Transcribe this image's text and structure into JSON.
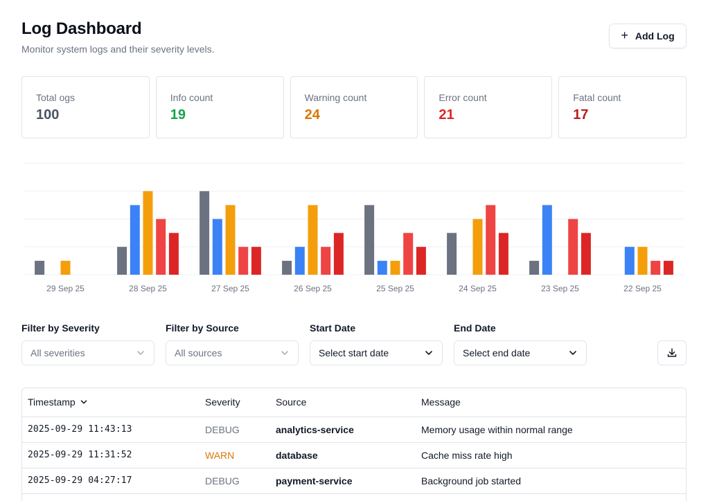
{
  "header": {
    "title": "Log Dashboard",
    "subtitle": "Monitor system logs and their severity levels."
  },
  "add_button": {
    "label": "Add Log"
  },
  "stats": [
    {
      "label": "Total ogs",
      "value": "100",
      "color": "#4b5563"
    },
    {
      "label": "Info count",
      "value": "19",
      "color": "#16a34a"
    },
    {
      "label": "Warning count",
      "value": "24",
      "color": "#d97706"
    },
    {
      "label": "Error count",
      "value": "21",
      "color": "#dc2626"
    },
    {
      "label": "Fatal count",
      "value": "17",
      "color": "#b91c1c"
    }
  ],
  "chart_data": {
    "type": "bar",
    "categories": [
      "29 Sep 25",
      "28 Sep 25",
      "27 Sep 25",
      "26 Sep 25",
      "25 Sep 25",
      "24 Sep 25",
      "23 Sep 25",
      "22 Sep 25"
    ],
    "series": [
      {
        "color": "#6b7280",
        "values": [
          1,
          2,
          6,
          1,
          5,
          3,
          1,
          0
        ]
      },
      {
        "color": "#3b82f6",
        "values": [
          0,
          5,
          4,
          2,
          1,
          0,
          5,
          2
        ]
      },
      {
        "color": "#f59e0b",
        "values": [
          1,
          6,
          5,
          5,
          1,
          4,
          0,
          2
        ]
      },
      {
        "color": "#ef4444",
        "values": [
          0,
          4,
          2,
          2,
          3,
          5,
          4,
          1
        ]
      },
      {
        "color": "#dc2626",
        "values": [
          0,
          3,
          2,
          3,
          2,
          3,
          3,
          1
        ]
      }
    ],
    "ylim": [
      0,
      8
    ],
    "grid": true
  },
  "filters": {
    "severity": {
      "label": "Filter by Severity",
      "value": "All severities"
    },
    "source": {
      "label": "Filter by Source",
      "value": "All sources"
    },
    "start": {
      "label": "Start Date",
      "value": "Select start date"
    },
    "end": {
      "label": "End Date",
      "value": "Select end date"
    }
  },
  "table": {
    "columns": [
      "Timestamp",
      "Severity",
      "Source",
      "Message"
    ],
    "rows": [
      {
        "timestamp": "2025-09-29 11:43:13",
        "severity": "DEBUG",
        "severity_color": "#6b7280",
        "source": "analytics-service",
        "message": "Memory usage within normal range"
      },
      {
        "timestamp": "2025-09-29 11:31:52",
        "severity": "WARN",
        "severity_color": "#d97706",
        "source": "database",
        "message": "Cache miss rate high"
      },
      {
        "timestamp": "2025-09-29 04:27:17",
        "severity": "DEBUG",
        "severity_color": "#6b7280",
        "source": "payment-service",
        "message": "Background job started"
      }
    ]
  }
}
